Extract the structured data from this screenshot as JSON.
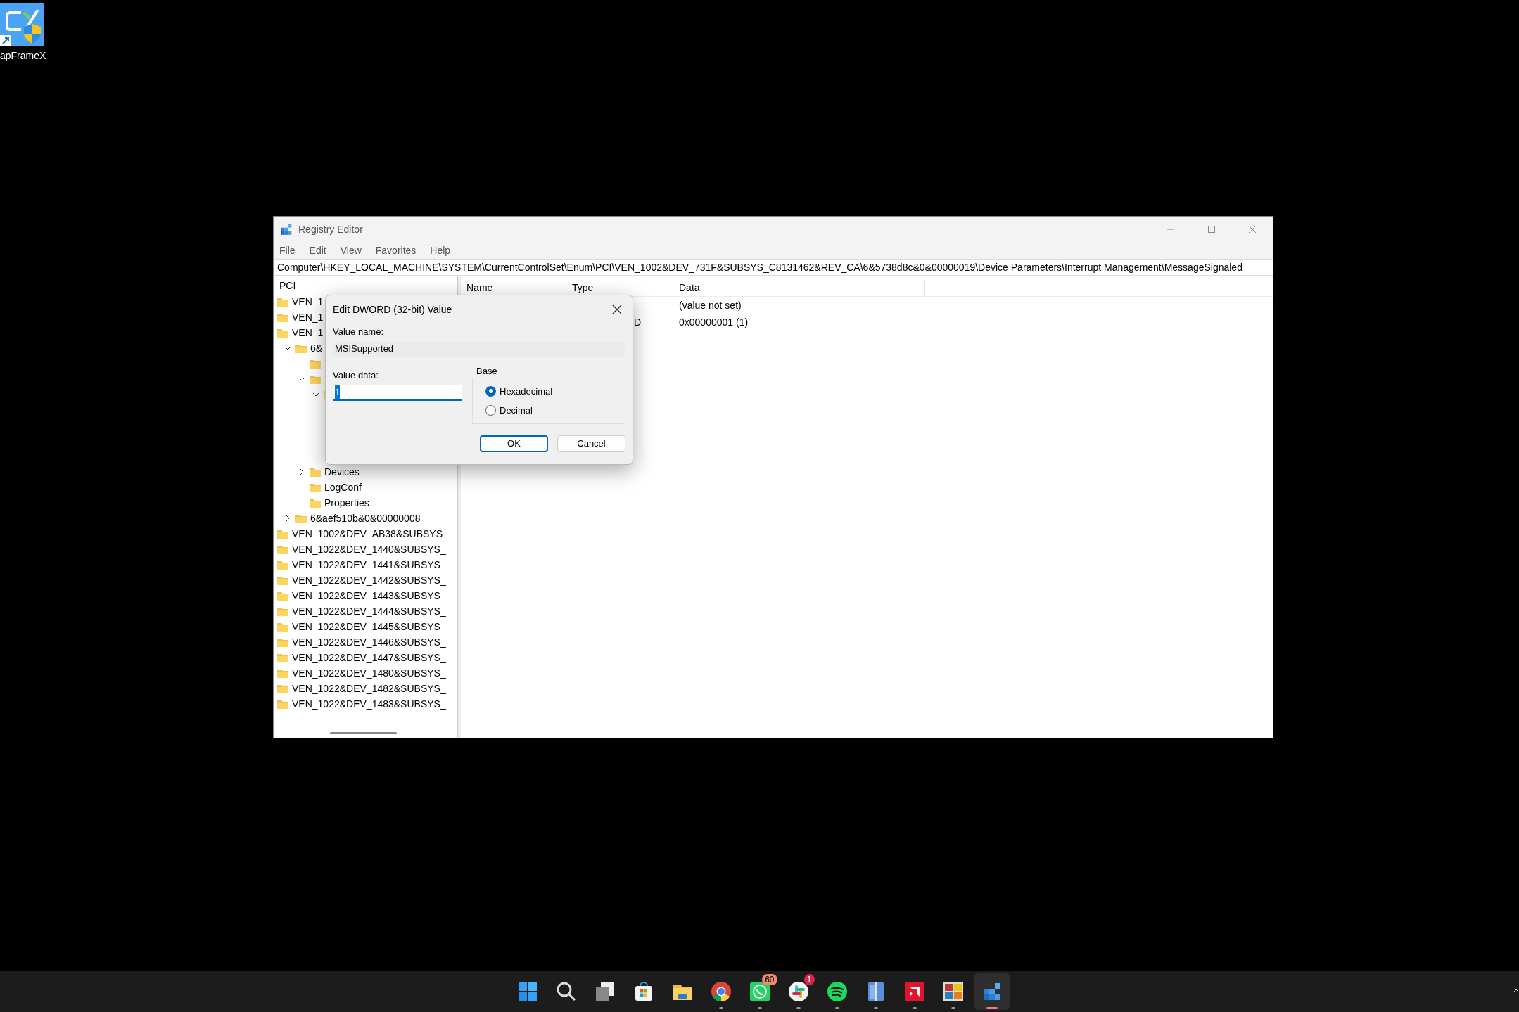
{
  "desktop_icon": {
    "label": "apFrameX"
  },
  "window": {
    "title": "Registry Editor",
    "menu": [
      "File",
      "Edit",
      "View",
      "Favorites",
      "Help"
    ],
    "address": "Computer\\HKEY_LOCAL_MACHINE\\SYSTEM\\CurrentControlSet\\Enum\\PCI\\VEN_1002&DEV_731F&SUBSYS_C8131462&REV_CA\\6&5738d8c&0&00000019\\Device Parameters\\Interrupt Management\\MessageSignaled",
    "tree": {
      "root": "PCI",
      "items": [
        {
          "label": "VEN_1"
        },
        {
          "label": "VEN_1"
        },
        {
          "label": "VEN_1",
          "children": [
            {
              "label": "6&",
              "expanded": true,
              "children": [
                {
                  "kind": "folder"
                },
                {
                  "expanded": true,
                  "children": [
                    {
                      "expanded": true
                    }
                  ]
                },
                {
                  "label": "Devices",
                  "expanded": false
                },
                {
                  "label": "LogConf"
                },
                {
                  "label": "Properties"
                }
              ]
            },
            {
              "label": "6&aef510b&0&00000008",
              "expanded": false
            }
          ]
        },
        {
          "label": "VEN_1002&DEV_AB38&SUBSYS_"
        },
        {
          "label": "VEN_1022&DEV_1440&SUBSYS_"
        },
        {
          "label": "VEN_1022&DEV_1441&SUBSYS_"
        },
        {
          "label": "VEN_1022&DEV_1442&SUBSYS_"
        },
        {
          "label": "VEN_1022&DEV_1443&SUBSYS_"
        },
        {
          "label": "VEN_1022&DEV_1444&SUBSYS_"
        },
        {
          "label": "VEN_1022&DEV_1445&SUBSYS_"
        },
        {
          "label": "VEN_1022&DEV_1446&SUBSYS_"
        },
        {
          "label": "VEN_1022&DEV_1447&SUBSYS_"
        },
        {
          "label": "VEN_1022&DEV_1480&SUBSYS_"
        },
        {
          "label": "VEN_1022&DEV_1482&SUBSYS_"
        },
        {
          "label": "VEN_1022&DEV_1483&SUBSYS_"
        }
      ]
    },
    "list": {
      "columns": [
        "Name",
        "Type",
        "Data"
      ],
      "rows": [
        {
          "data": "(value not set)"
        },
        {
          "type": "D",
          "data": "0x00000001 (1)"
        }
      ]
    }
  },
  "dialog": {
    "title": "Edit DWORD (32-bit) Value",
    "value_name_label": "Value name:",
    "value_name": "MSISupported",
    "value_data_label": "Value data:",
    "value_data": "1",
    "value_data_selected": true,
    "base_label": "Base",
    "bases": [
      {
        "label": "Hexadecimal",
        "selected": true
      },
      {
        "label": "Decimal",
        "selected": false
      }
    ],
    "buttons": [
      {
        "label": "OK",
        "default": true
      },
      {
        "label": "Cancel",
        "default": false
      }
    ]
  },
  "taskbar": {
    "items": [
      {
        "kind": "start",
        "running": false,
        "active": false
      },
      {
        "kind": "search",
        "running": false,
        "active": false
      },
      {
        "kind": "taskview",
        "running": false,
        "active": false
      },
      {
        "kind": "store",
        "running": false,
        "active": false
      },
      {
        "kind": "explorer",
        "running": false,
        "active": false
      },
      {
        "kind": "chrome",
        "running": true,
        "active": false
      },
      {
        "kind": "whatsapp",
        "running": true,
        "active": false,
        "badge": "60"
      },
      {
        "kind": "slack",
        "running": true,
        "active": false,
        "badge": "1"
      },
      {
        "kind": "spotify",
        "running": true,
        "active": false
      },
      {
        "kind": "bluebook",
        "running": true,
        "active": false
      },
      {
        "kind": "amd",
        "running": true,
        "active": false
      },
      {
        "kind": "tiles",
        "running": true,
        "active": false
      },
      {
        "kind": "regedit",
        "running": true,
        "active": true
      }
    ]
  }
}
